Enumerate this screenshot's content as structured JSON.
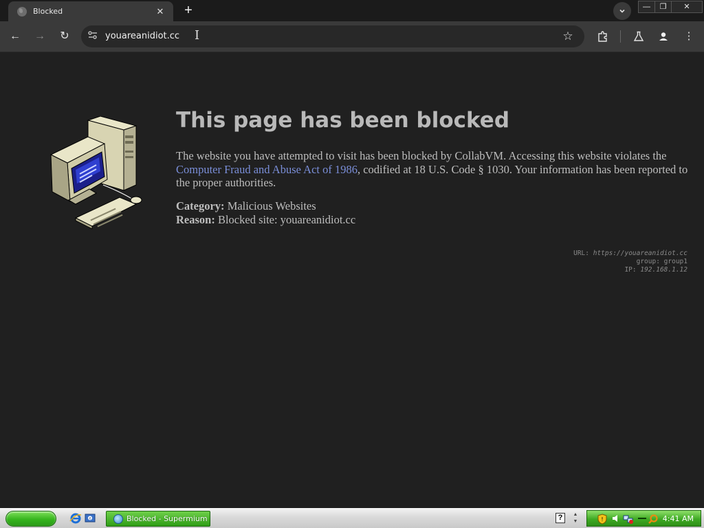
{
  "browser": {
    "tab": {
      "title": "Blocked",
      "close_icon": "✕"
    },
    "new_tab_icon": "+",
    "tab_search_icon": "⌄",
    "window_controls": {
      "minimize": "—",
      "restore": "❐",
      "close": "✕"
    },
    "toolbar": {
      "back_icon": "←",
      "forward_icon": "→",
      "reload_icon": "↻",
      "url": "youareanidiot.cc",
      "bookmark_icon": "☆",
      "extensions_icon": "⧉",
      "labs_icon": "⚗",
      "menu_icon": "⋮"
    }
  },
  "page": {
    "title": "This page has been blocked",
    "desc_part1": "The website you have attempted to visit has been blocked by CollabVM. Accessing this website violates the ",
    "desc_link": "Computer Fraud and Abuse Act of 1986",
    "desc_part2": ", codified at 18 U.S. Code § 1030. Your information has been reported to the proper authorities.",
    "category_label": "Category:",
    "category_value": "Malicious Websites",
    "reason_label": "Reason:",
    "reason_value": "Blocked site: youareanidiot.cc",
    "meta": {
      "url_label": "URL:",
      "url_value": "https://youareanidiot.cc",
      "group_label": "group:",
      "group_value": "group1",
      "ip_label": "IP:",
      "ip_value": "192.168.1.12"
    }
  },
  "taskbar": {
    "task_label": "Blocked - Supermium",
    "clock": "4:41 AM",
    "help_icon": "?"
  },
  "colors": {
    "page_bg": "#202020",
    "title": "#b9b9b9",
    "body_text": "#bdbdbd",
    "link": "#7a8ed8",
    "meta_text": "#8a8a8a",
    "taskbar_green": "#3faa24"
  }
}
